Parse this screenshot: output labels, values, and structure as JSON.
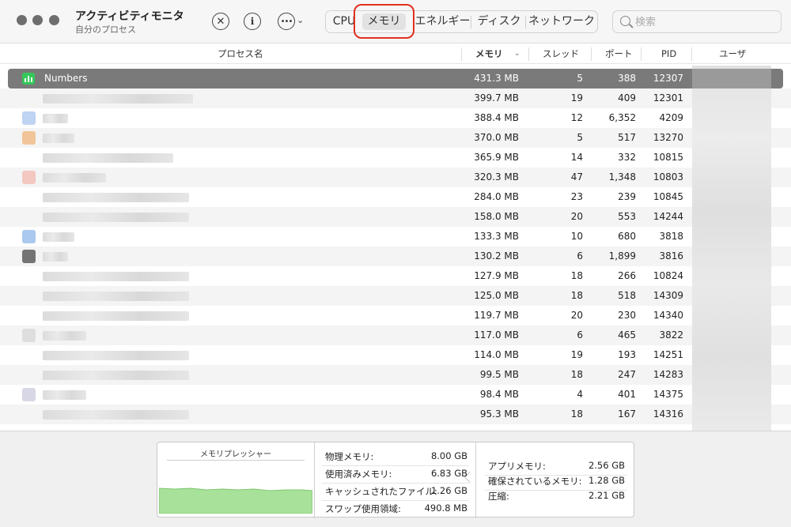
{
  "window": {
    "title": "アクティビティモニタ",
    "subtitle": "自分のプロセス"
  },
  "toolbar": {
    "stop_icon": "x-circle-icon",
    "info_icon": "info-icon",
    "more_icon": "ellipsis-circle-icon",
    "tabs": [
      {
        "label": "CPU",
        "active": false
      },
      {
        "label": "メモリ",
        "active": true
      },
      {
        "label": "エネルギー",
        "active": false
      },
      {
        "label": "ディスク",
        "active": false
      },
      {
        "label": "ネットワーク",
        "active": false
      }
    ],
    "search_placeholder": "検索"
  },
  "table": {
    "headers": {
      "name": "プロセス名",
      "memory": "メモリ",
      "threads": "スレッド",
      "ports": "ポート",
      "pid": "PID",
      "user": "ユーザ"
    },
    "selected_process_name": "Numbers",
    "rows": [
      {
        "memory": "431.3 MB",
        "threads": "5",
        "ports": "388",
        "pid": "12307"
      },
      {
        "memory": "399.7 MB",
        "threads": "19",
        "ports": "409",
        "pid": "12301"
      },
      {
        "memory": "388.4 MB",
        "threads": "12",
        "ports": "6,352",
        "pid": "4209"
      },
      {
        "memory": "370.0 MB",
        "threads": "5",
        "ports": "517",
        "pid": "13270"
      },
      {
        "memory": "365.9 MB",
        "threads": "14",
        "ports": "332",
        "pid": "10815"
      },
      {
        "memory": "320.3 MB",
        "threads": "47",
        "ports": "1,348",
        "pid": "10803"
      },
      {
        "memory": "284.0 MB",
        "threads": "23",
        "ports": "239",
        "pid": "10845"
      },
      {
        "memory": "158.0 MB",
        "threads": "20",
        "ports": "553",
        "pid": "14244"
      },
      {
        "memory": "133.3 MB",
        "threads": "10",
        "ports": "680",
        "pid": "3818"
      },
      {
        "memory": "130.2 MB",
        "threads": "6",
        "ports": "1,899",
        "pid": "3816"
      },
      {
        "memory": "127.9 MB",
        "threads": "18",
        "ports": "266",
        "pid": "10824"
      },
      {
        "memory": "125.0 MB",
        "threads": "18",
        "ports": "518",
        "pid": "14309"
      },
      {
        "memory": "119.7 MB",
        "threads": "20",
        "ports": "230",
        "pid": "14340"
      },
      {
        "memory": "117.0 MB",
        "threads": "6",
        "ports": "465",
        "pid": "3822"
      },
      {
        "memory": "114.0 MB",
        "threads": "19",
        "ports": "193",
        "pid": "14251"
      },
      {
        "memory": "99.5 MB",
        "threads": "18",
        "ports": "247",
        "pid": "14283"
      },
      {
        "memory": "98.4 MB",
        "threads": "4",
        "ports": "401",
        "pid": "14375"
      },
      {
        "memory": "95.3 MB",
        "threads": "18",
        "ports": "167",
        "pid": "14316"
      }
    ]
  },
  "memory_panel": {
    "pressure_title": "メモリプレッシャー",
    "pressure_color": "#a8e29a",
    "stats_left": [
      {
        "label": "物理メモリ:",
        "value": "8.00 GB"
      },
      {
        "label": "使用済みメモリ:",
        "value": "6.83 GB"
      },
      {
        "label": "キャッシュされたファイル:",
        "value": "1.26 GB"
      },
      {
        "label": "スワップ使用領域:",
        "value": "490.8 MB"
      }
    ],
    "stats_right": [
      {
        "label": "アプリメモリ:",
        "value": "2.56 GB"
      },
      {
        "label": "確保されているメモリ:",
        "value": "1.28 GB"
      },
      {
        "label": "圧縮:",
        "value": "2.21 GB"
      }
    ]
  },
  "colors": {
    "selection": "#7a7a7a",
    "highlight_ring": "#e0301e",
    "numbers_app_green": "#34c759"
  }
}
